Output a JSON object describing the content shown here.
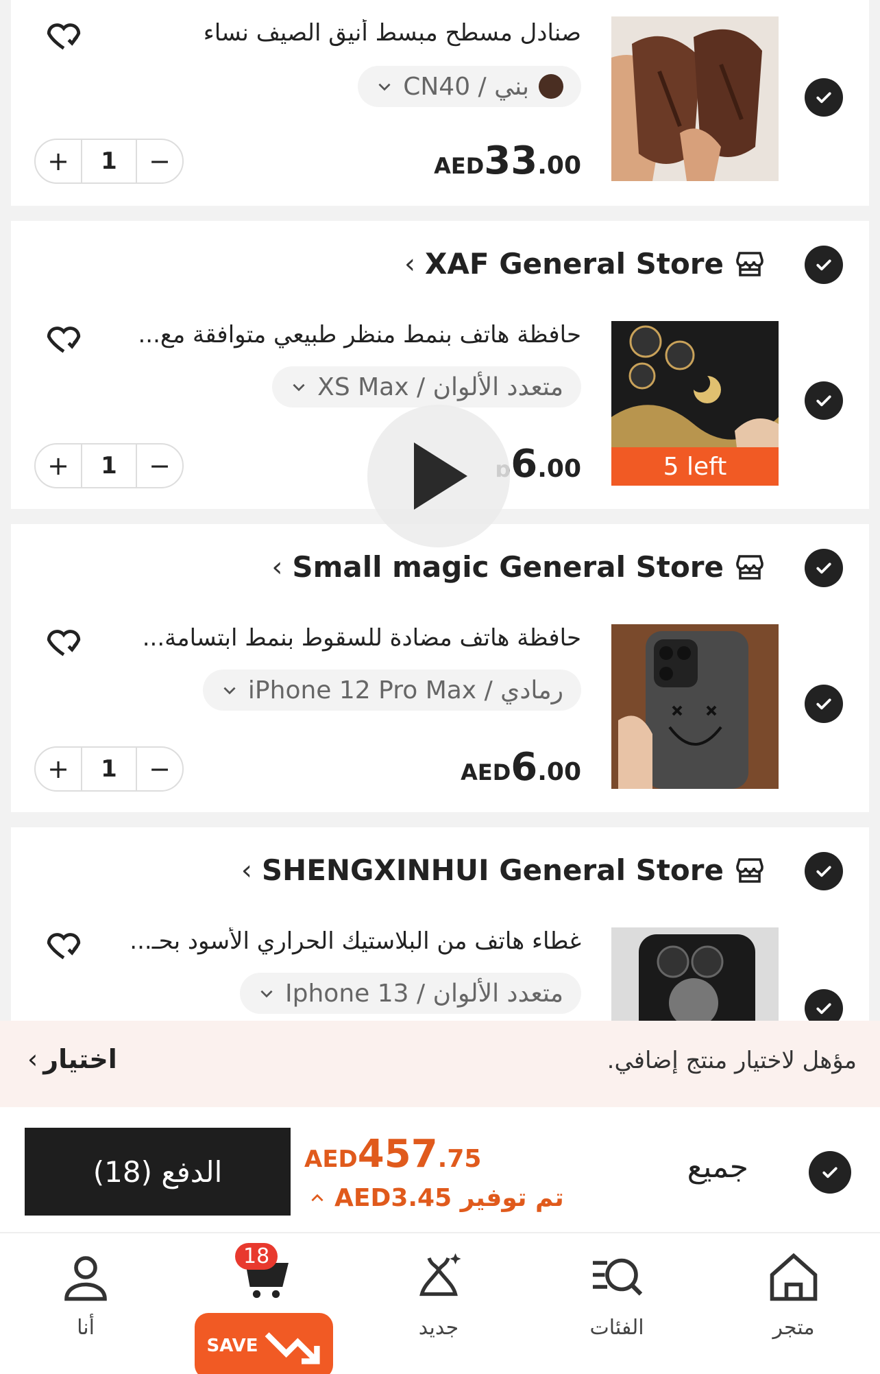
{
  "items": [
    {
      "title": "صنادل مسطح مبسط أنيق الصيف نساء",
      "variant": "بني / CN40",
      "price_currency": "AED",
      "price_int": "33",
      "price_dec": ".00",
      "qty": "1",
      "badge": ""
    },
    {
      "title": "حافظة هاتف بنمط منظر طبيعي متوافقة مع...",
      "variant": "متعدد الألوان / XS Max",
      "price_currency": "",
      "price_int": "6",
      "price_dec": ".00",
      "price_partial": "ɒ",
      "qty": "1",
      "badge": "5 left"
    },
    {
      "title": "حافظة هاتف مضادة للسقوط بنمط ابتسامة...",
      "variant": "رمادي / iPhone 12 Pro Max",
      "price_currency": "AED",
      "price_int": "6",
      "price_dec": ".00",
      "qty": "1",
      "badge": ""
    },
    {
      "title": "غطاء هاتف من البلاستيك الحراري الأسود بحـ...",
      "variant": "متعدد الألوان / Iphone 13"
    }
  ],
  "stores": [
    "XAF General Store",
    "Small magic General Store",
    "SHENGXINHUI General Store"
  ],
  "stepper": {
    "plus": "+",
    "minus": "−"
  },
  "promo": {
    "text": "مؤهل لاختيار منتج إضافي.",
    "link": "اختيار"
  },
  "checkout": {
    "pay_button": "الدفع (18)",
    "total_currency": "AED",
    "total_int": "457",
    "total_dec": ".75",
    "saved": "تم توفير AED3.45",
    "select_all": "جميع"
  },
  "tabs": [
    {
      "label": "أنا",
      "icon": "user-icon"
    },
    {
      "label": "",
      "icon": "cart-icon",
      "badge": "18",
      "pill": "SAVE"
    },
    {
      "label": "جديد",
      "icon": "new-sparkle-icon"
    },
    {
      "label": "الفئات",
      "icon": "categories-search-icon"
    },
    {
      "label": "متجر",
      "icon": "home-icon"
    }
  ],
  "colors": {
    "accent": "#f15a24",
    "price_orange": "#e05a1c",
    "dark": "#1e1e1e",
    "promo_bg": "#fbf1ee"
  }
}
